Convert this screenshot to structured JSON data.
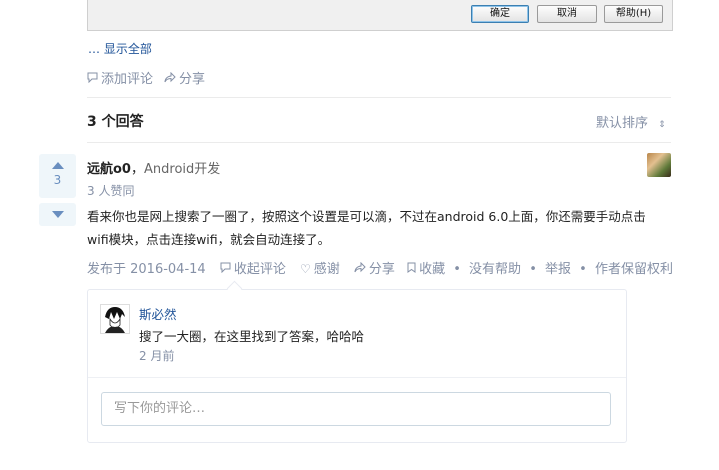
{
  "dialog": {
    "ok_label": "确定",
    "cancel_label": "取消",
    "help_label": "帮助(H)"
  },
  "question": {
    "show_all": "… 显示全部",
    "add_comment": "添加评论",
    "share": "分享"
  },
  "answers_header": {
    "count_label": "3 个回答",
    "sort_label": "默认排序"
  },
  "answer": {
    "vote_count": "3",
    "author_name": "远航o0",
    "author_sep": "，",
    "author_bio": "Android开发",
    "upvoters": "3 人赞同",
    "content_line1": "看来你也是网上搜索了一圈了，按照这个设置是可以滴，不过在android 6.0上面，你还需要手动点击",
    "content_line2": "wifi模块，点击连接wifi，就会自动连接了。",
    "date": "发布于 2016-04-14",
    "collapse_comments": "收起评论",
    "thanks": "感谢",
    "share": "分享",
    "collect": "收藏",
    "no_help": "没有帮助",
    "report": "举报",
    "copyright": "作者保留权利",
    "dot": "•"
  },
  "comment": {
    "author": "斯必然",
    "text": "搜了一大圈，在这里找到了答案，哈哈哈",
    "time": "2 月前",
    "input_placeholder": "写下你的评论…"
  },
  "icons": {
    "comment": "comment-icon",
    "share": "share-icon",
    "heart": "heart-icon",
    "bookmark": "bookmark-icon"
  },
  "colors": {
    "link": "#225599",
    "meta": "#8590a6",
    "vote_bg": "#eff6fa",
    "vote_fg": "#698ebf"
  }
}
